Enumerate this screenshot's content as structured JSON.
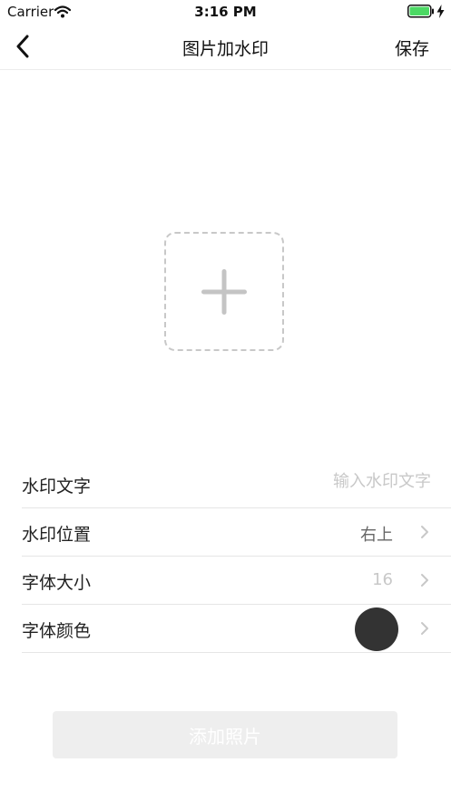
{
  "status_bar": {
    "carrier": "Carrier",
    "time": "3:16 PM"
  },
  "nav": {
    "title": "图片加水印",
    "save_label": "保存"
  },
  "upload": {
    "icon": "plus-icon"
  },
  "settings": {
    "watermark_text_label": "水印文字",
    "watermark_text_placeholder": "输入水印文字",
    "position_label": "水印位置",
    "position_value": "右上",
    "font_size_label": "字体大小",
    "font_size_value": "16",
    "font_color_label": "字体颜色",
    "font_color": "#333333"
  },
  "action": {
    "add_photo_label": "添加照片"
  },
  "colors": {
    "battery": "#4cd964",
    "placeholder": "#c8c8c8",
    "button_bg": "#eeeeee"
  }
}
